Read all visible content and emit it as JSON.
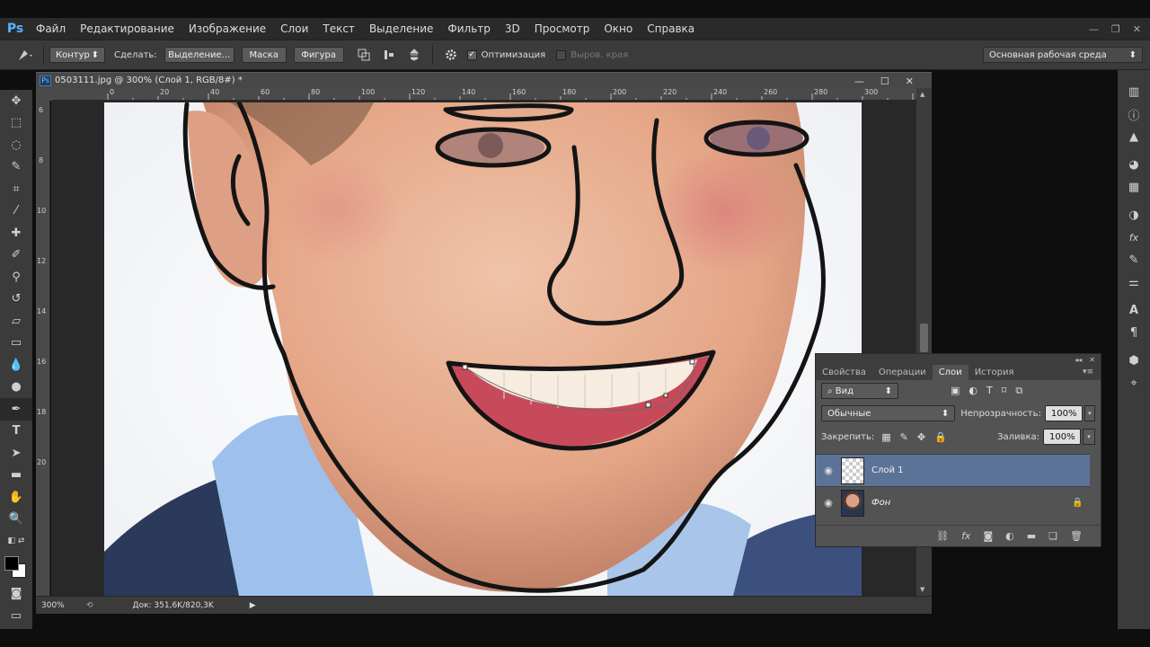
{
  "app": {
    "logo": "Ps"
  },
  "menu": [
    "Файл",
    "Редактирование",
    "Изображение",
    "Слои",
    "Текст",
    "Выделение",
    "Фильтр",
    "3D",
    "Просмотр",
    "Окно",
    "Справка"
  ],
  "window_controls": {
    "minimize": "—",
    "restore": "❐",
    "close": "✕"
  },
  "options": {
    "mode": "Контур",
    "make_label": "Сделать:",
    "selection_btn": "Выделение...",
    "mask_btn": "Маска",
    "shape_btn": "Фигура",
    "optimize_label": "Оптимизация",
    "align_edges_label": "Выров. края",
    "workspace": "Основная рабочая среда"
  },
  "document": {
    "title": "0503111.jpg @ 300% (Слой 1, RGB/8#) *",
    "ps_badge": "Ps",
    "ruler_top": [
      "0",
      "20",
      "40",
      "60",
      "80",
      "100",
      "120",
      "140",
      "160",
      "180",
      "200",
      "220",
      "240",
      "260",
      "280",
      "300"
    ],
    "ruler_left": [
      "6",
      "8",
      "10",
      "12",
      "14",
      "16",
      "18",
      "20"
    ]
  },
  "status": {
    "zoom": "300%",
    "doc_size": "Док: 351,6K/820,3K"
  },
  "layers_panel": {
    "tabs": [
      "Свойства",
      "Операции",
      "Слои",
      "История"
    ],
    "active_tab": "Слои",
    "filter_label": "Вид",
    "blend_mode": "Обычные",
    "opacity_label": "Непрозрачность:",
    "opacity_value": "100%",
    "lock_label": "Закрепить:",
    "fill_label": "Заливка:",
    "fill_value": "100%",
    "layers": [
      {
        "name": "Слой 1",
        "selected": true,
        "thumb": "transparent"
      },
      {
        "name": "Фон",
        "selected": false,
        "thumb": "photo",
        "locked": true
      }
    ]
  },
  "colors": {
    "accent": "#5b7396",
    "panel": "#535353",
    "toolbar": "#3b3b3b"
  }
}
